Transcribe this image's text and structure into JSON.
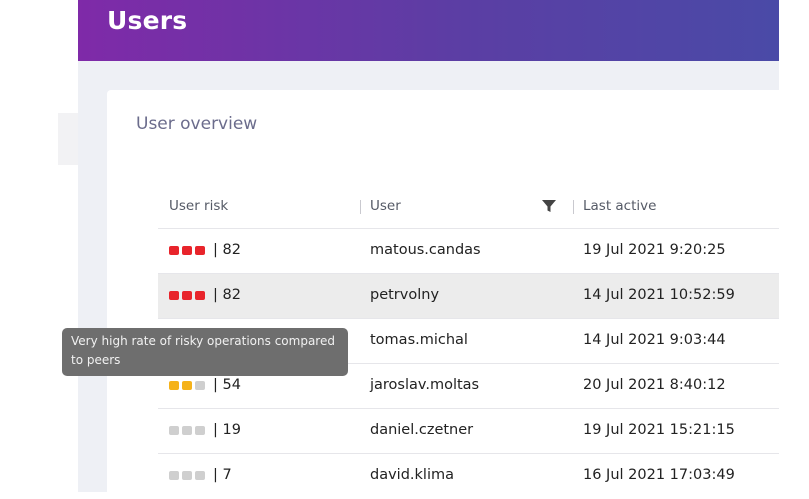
{
  "header": {
    "title": "Users"
  },
  "card": {
    "title": "User overview"
  },
  "table": {
    "columns": {
      "risk": "User risk",
      "user": "User",
      "last_active": "Last active"
    },
    "rows": [
      {
        "risk_text": "| 82",
        "dots": [
          "#e8242b",
          "#e8242b",
          "#e8242b"
        ],
        "user": "matous.candas",
        "last_active": "19 Jul 2021 9:20:25"
      },
      {
        "risk_text": "| 82",
        "dots": [
          "#e8242b",
          "#e8242b",
          "#e8242b"
        ],
        "user": "petrvolny",
        "last_active": "14 Jul 2021 10:52:59"
      },
      {
        "risk_text": "",
        "dots": [],
        "user": "tomas.michal",
        "last_active": "14 Jul 2021 9:03:44"
      },
      {
        "risk_text": "| 54",
        "dots": [
          "#f5b21a",
          "#f5b21a",
          "#cfcfcf"
        ],
        "user": "jaroslav.moltas",
        "last_active": "20 Jul 2021 8:40:12"
      },
      {
        "risk_text": "| 19",
        "dots": [
          "#cfcfcf",
          "#cfcfcf",
          "#cfcfcf"
        ],
        "user": "daniel.czetner",
        "last_active": "19 Jul 2021 15:21:15"
      },
      {
        "risk_text": "| 7",
        "dots": [
          "#cfcfcf",
          "#cfcfcf",
          "#cfcfcf"
        ],
        "user": "david.klima",
        "last_active": "16 Jul 2021 17:03:49"
      }
    ]
  },
  "tooltip": {
    "text": "Very high rate of risky operations compared to peers"
  },
  "icons": {
    "filter": "filter-icon"
  }
}
